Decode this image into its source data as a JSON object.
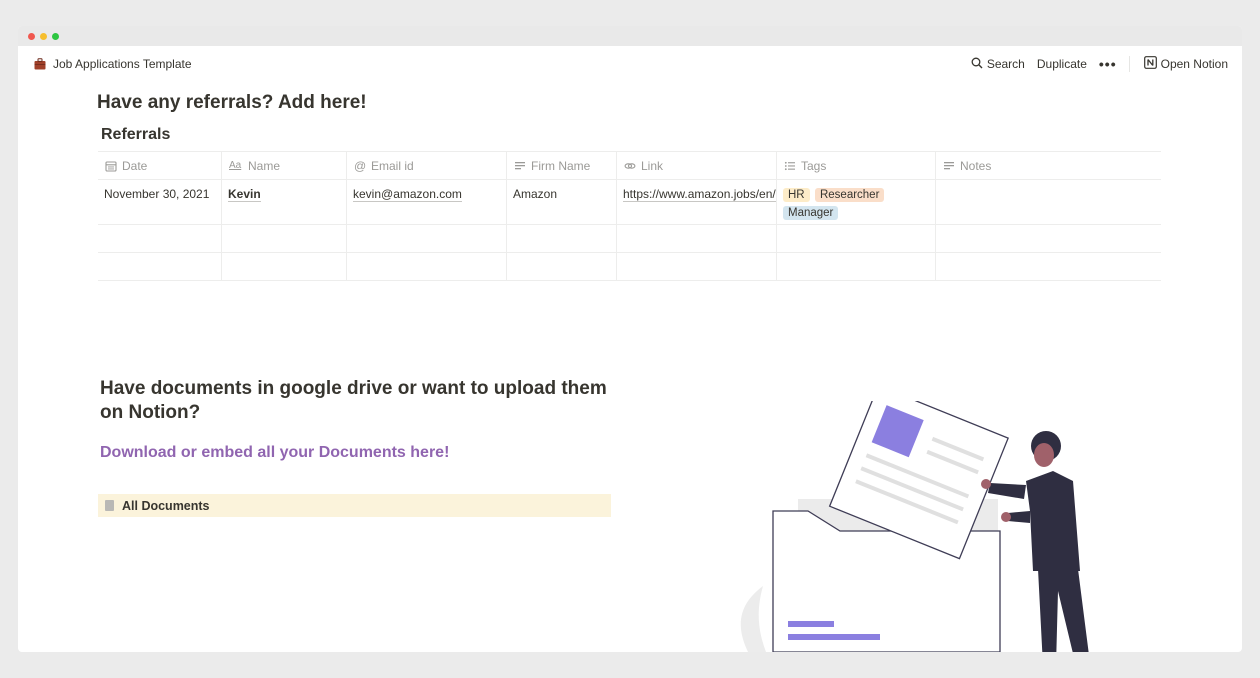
{
  "topbar": {
    "breadcrumb": "Job Applications Template",
    "search_label": "Search",
    "duplicate_label": "Duplicate",
    "more_label": "•••",
    "open_notion_label": "Open Notion"
  },
  "page": {
    "referrals_heading": "Have any referrals? Add here!",
    "table_title": "Referrals",
    "documents_heading": "Have documents in google drive or want to upload them on Notion?",
    "documents_subheading": "Download or embed all your Documents here!",
    "all_documents_label": "All Documents"
  },
  "table": {
    "columns": [
      "Date",
      "Name",
      "Email id",
      "Firm Name",
      "Link",
      "Tags",
      "Notes"
    ],
    "rows": [
      {
        "date": "November 30, 2021",
        "name": "Kevin",
        "email": "kevin@amazon.com",
        "firm": "Amazon",
        "link": "https://www.amazon.jobs/en/",
        "tags": [
          "HR",
          "Researcher",
          "Manager"
        ],
        "notes": ""
      }
    ]
  },
  "colors": {
    "accent_purple": "#9065b0",
    "callout_bg": "#fbf3db",
    "illustration_purple": "#8b7fe0",
    "figure_navy": "#2f2e41"
  }
}
